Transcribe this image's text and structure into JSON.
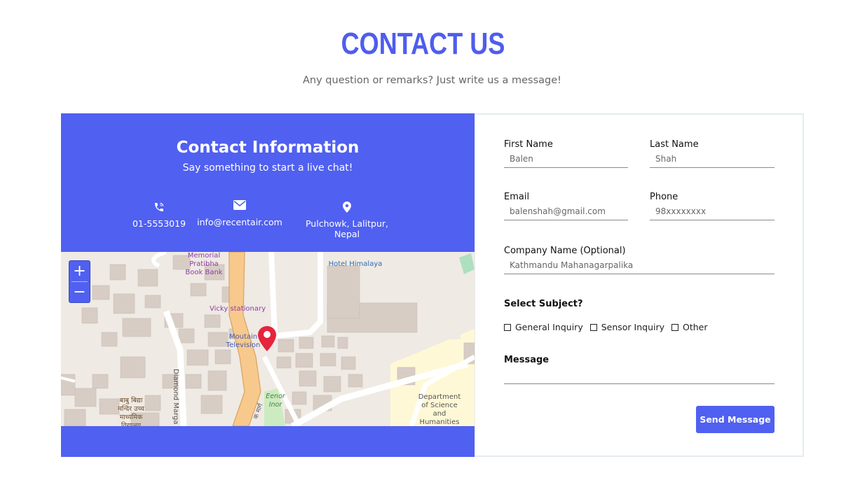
{
  "header": {
    "title": "CONTACT US",
    "subtitle": "Any question or remarks? Just write us a message!"
  },
  "contact_info": {
    "title": "Contact Information",
    "subtitle": "Say something to start a live chat!",
    "phone": "01-5553019",
    "email": "info@recentair.com",
    "address": "Pulchowk, Lalitpur, Nepal",
    "phone_icon": "phone-icon",
    "email_icon": "envelope-icon",
    "address_icon": "map-pin-icon"
  },
  "map": {
    "zoom_in": "+",
    "zoom_out": "−",
    "labels": {
      "memorial": "Memorial\nPratibha\nBook Bank",
      "vicky": "Vicky stationary",
      "moutain": "Moutain\nTelevision",
      "hotel": "Hotel Himalaya",
      "diamond": "Diamond Marga",
      "department": "Department\nof Science\nand\nHumanities",
      "school": "बाबु बिद्या\nमन्दिर उच्च\nमाध्यमिक\nविद्यालय",
      "eenor": "Eenor\nInor",
      "road": "क मार्ग"
    }
  },
  "form": {
    "first_name": {
      "label": "First Name",
      "placeholder": "Balen"
    },
    "last_name": {
      "label": "Last Name",
      "placeholder": "Shah"
    },
    "email": {
      "label": "Email",
      "placeholder": "balenshah@gmail.com"
    },
    "phone": {
      "label": "Phone",
      "placeholder": "98xxxxxxxx"
    },
    "company": {
      "label": "Company Name (Optional)",
      "placeholder": "Kathmandu Mahanagarpalika"
    },
    "subject_title": "Select Subject?",
    "subjects": [
      "General Inquiry",
      "Sensor Inquiry",
      "Other"
    ],
    "message_label": "Message",
    "send_label": "Send Message"
  },
  "colors": {
    "accent": "#5060f0"
  }
}
